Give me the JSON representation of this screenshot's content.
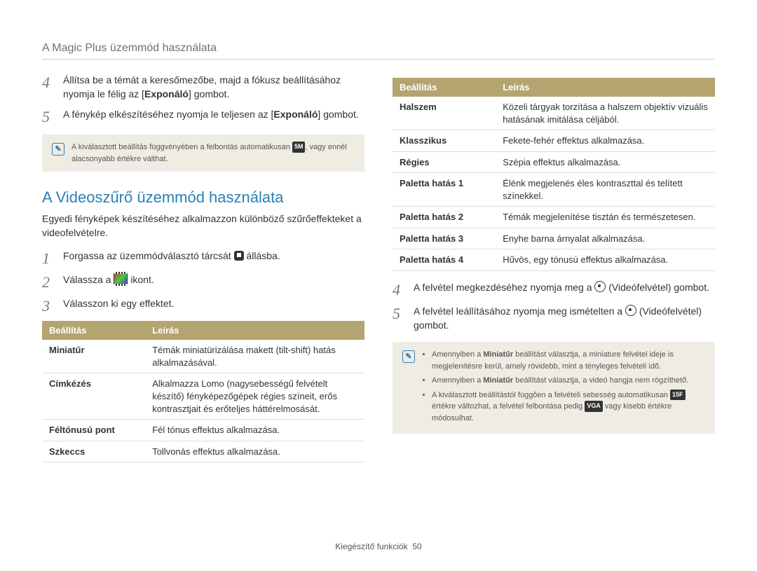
{
  "header": "A Magic Plus üzemmód használata",
  "left": {
    "steps_a": [
      {
        "num": "4",
        "html": "Állítsa be a témát a keresőmezőbe, majd a fókusz beállításához nyomja le félig az [<b>Exponáló</b>] gombot."
      },
      {
        "num": "5",
        "html": "A fénykép elkészítéséhez nyomja le teljesen az [<b>Exponáló</b>] gombot."
      }
    ],
    "note_a": "A kiválasztott beállítás függvényében a felbontás automatikusan <span class=\"res-box\">5M</span>, vagy ennél alacsonyabb értékre válthat.",
    "section_title": "A Videoszűrő üzemmód használata",
    "intro": "Egyedi fényképek készítéséhez alkalmazzon különböző szűrőeffekteket a videofelvételre.",
    "steps_b": [
      {
        "num": "1",
        "html": "Forgassa az üzemmódválasztó tárcsát <span class=\"mode-dial\" data-name=\"mode-dial-icon\" data-interactable=\"false\"></span> állásba."
      },
      {
        "num": "2",
        "html": "Válassza a <span class=\"movie-filter-icon\" data-name=\"movie-filter-icon\" data-interactable=\"false\"></span> ikont."
      },
      {
        "num": "3",
        "html": "Válasszon ki egy effektet."
      }
    ],
    "table": {
      "headers": [
        "Beállítás",
        "Leírás"
      ],
      "rows": [
        [
          "Miniatűr",
          "Témák miniatürizálása makett (tilt-shift) hatás alkalmazásával."
        ],
        [
          "Címkézés",
          "Alkalmazza Lomo (nagysebességű felvételt készítő) fényképezőgépek régies színeit, erős kontrasztjait és erőteljes háttérelmosását."
        ],
        [
          "Féltónusú pont",
          "Fél tónus effektus alkalmazása."
        ],
        [
          "Szkeccs",
          "Tollvonás effektus alkalmazása."
        ]
      ]
    }
  },
  "right": {
    "table": {
      "headers": [
        "Beállítás",
        "Leírás"
      ],
      "rows": [
        [
          "Halszem",
          "Közeli tárgyak torzítása a halszem objektív vizuális hatásának imitálása céljából."
        ],
        [
          "Klasszikus",
          "Fekete-fehér effektus alkalmazása."
        ],
        [
          "Régies",
          "Szépia effektus alkalmazása."
        ],
        [
          "Paletta hatás 1",
          "Élénk megjelenés éles kontraszttal és telített színekkel."
        ],
        [
          "Paletta hatás 2",
          "Témák megjelenítése tisztán és természetesen."
        ],
        [
          "Paletta hatás 3",
          "Enyhe barna árnyalat alkalmazása."
        ],
        [
          "Paletta hatás 4",
          "Hűvös, egy tónusú effektus alkalmazása."
        ]
      ]
    },
    "steps": [
      {
        "num": "4",
        "html": "A felvétel megkezdéséhez nyomja meg a <span class=\"rec-icon\" data-name=\"record-icon\" data-interactable=\"false\"></span> (Videófelvétel) gombot."
      },
      {
        "num": "5",
        "html": "A felvétel leállításához nyomja meg ismételten a <span class=\"rec-icon\" data-name=\"record-icon\" data-interactable=\"false\"></span> (Videófelvétel) gombot."
      }
    ],
    "note_items": [
      "Amennyiben a <b>Miniatűr</b> beállítást választja, a miniature felvétel ideje is megjelenítésre kerül, amely rövidebb, mint a tényleges felvételi idő.",
      "Amennyiben a <b>Miniatűr</b> beállítást választja, a videó hangja nem rögzíthető.",
      "A kiválasztott beállítástól függően a felvételi sebesség automatikusan <span class=\"res-box\">15F</span> értékre változhat, a felvétel felbontása pedig <span class=\"res-box\">VGA</span> vagy kisebb értékre módosulhat."
    ]
  },
  "footer": {
    "section": "Kiegészítő funkciók",
    "page": "50"
  }
}
